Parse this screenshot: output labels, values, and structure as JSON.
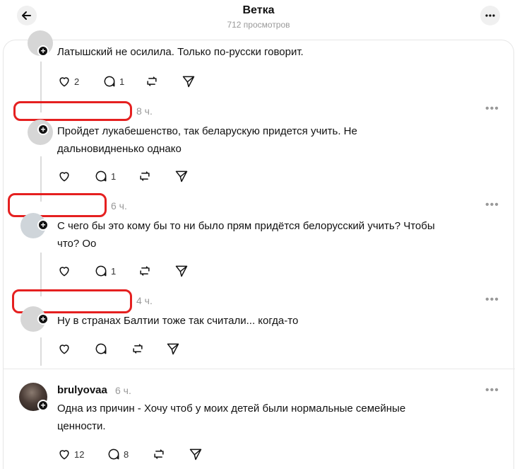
{
  "header": {
    "title": "Ветка",
    "views": "712 просмотров",
    "back_icon": "arrow-left-icon",
    "more_icon": "more-horizontal-icon"
  },
  "comments": [
    {
      "text": "Латышский не осилила. Только по-русски говорит.",
      "likes": "2",
      "replies": "1"
    },
    {
      "time": "8 ч.",
      "text_line1": "Пройдет лукабешенство, так беларускую придется учить. Не",
      "text_line2": "дальновидненько однако",
      "likes": "",
      "replies": "1"
    },
    {
      "time": "6 ч.",
      "text_line1": "С чего бы это кому бы то ни было прям придётся белорусский учить? Чтобы",
      "text_line2": "что? Оо",
      "likes": "",
      "replies": "1"
    },
    {
      "time": "4 ч.",
      "text_line1": "Ну в странах Балтии тоже так считали... когда-то",
      "likes": "",
      "replies": ""
    },
    {
      "username": "brulyovaa",
      "time": "6 ч.",
      "text_line1": "Одна из причин - Хочу чтоб у моих детей были нормальные семейные",
      "text_line2": "ценности.",
      "likes": "12",
      "replies": "8"
    }
  ],
  "colors": {
    "redaction": "#e52020",
    "muted": "#999999",
    "text": "#111111"
  }
}
